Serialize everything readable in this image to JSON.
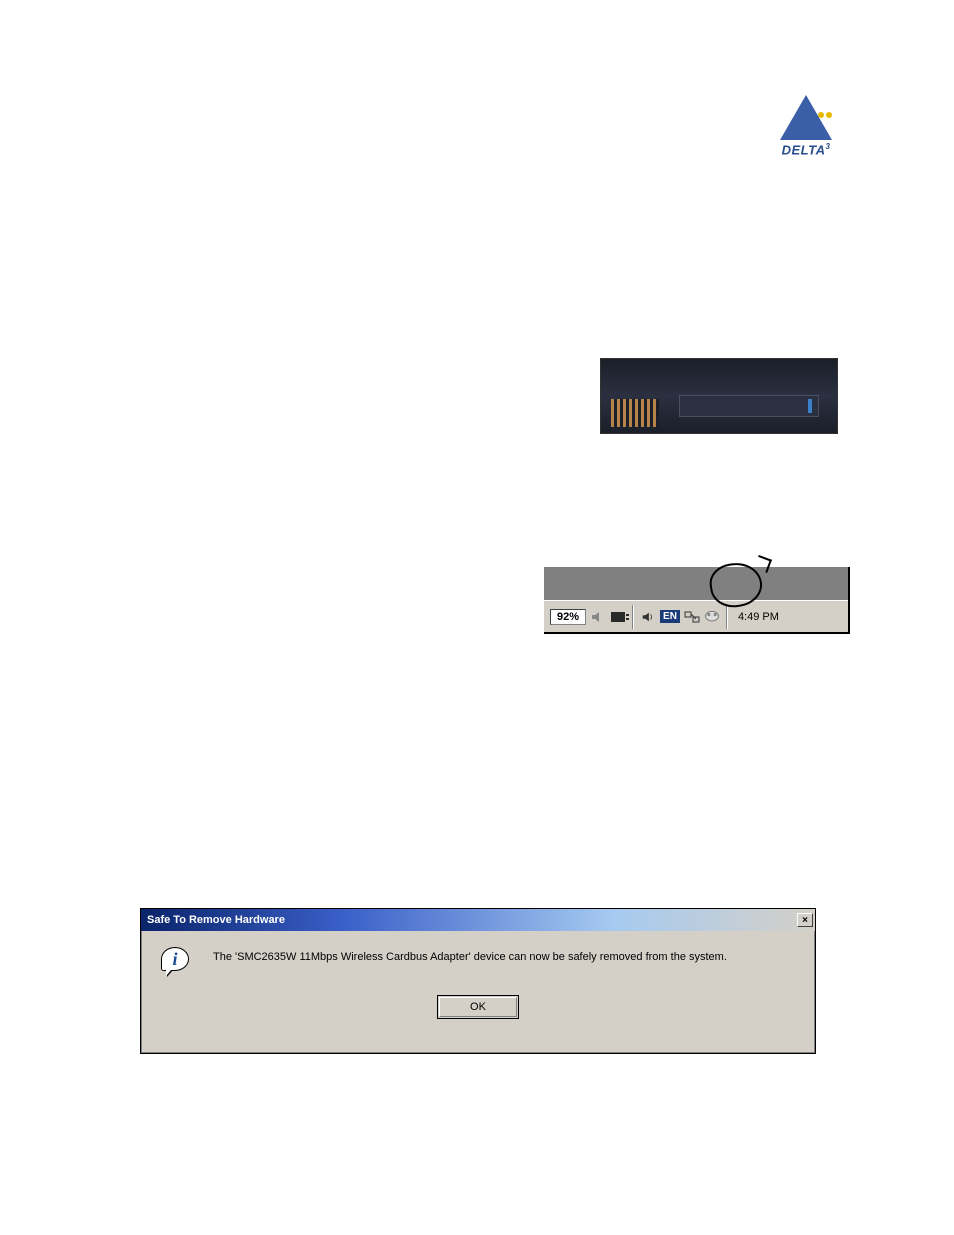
{
  "logo": {
    "text": "DELTA",
    "superscript": "3"
  },
  "systray": {
    "battery": "92%",
    "lang": "EN",
    "time": "4:49 PM"
  },
  "dialog": {
    "title": "Safe To Remove Hardware",
    "message": "The 'SMC2635W 11Mbps Wireless Cardbus Adapter' device can now be safely removed from the system.",
    "ok_label": "OK",
    "close_label": "×",
    "info_glyph": "i"
  }
}
